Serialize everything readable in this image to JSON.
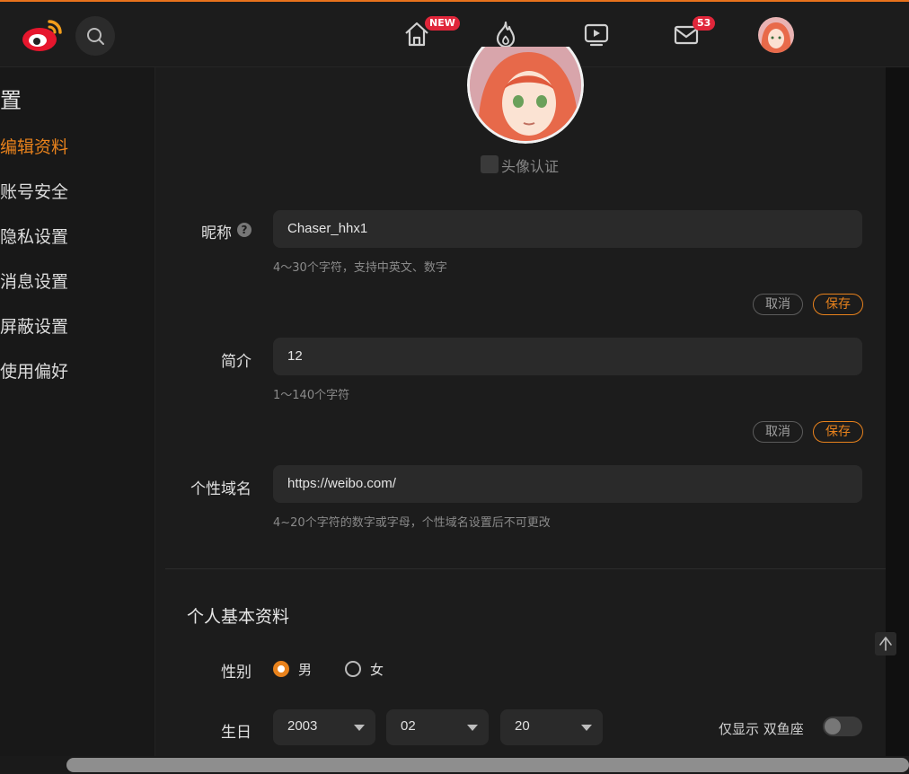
{
  "header": {
    "home_badge": "NEW",
    "messages_badge": "53"
  },
  "sidebar": {
    "title": "置",
    "items": [
      {
        "label": "编辑资料"
      },
      {
        "label": "账号安全"
      },
      {
        "label": "隐私设置"
      },
      {
        "label": "消息设置"
      },
      {
        "label": "屏蔽设置"
      },
      {
        "label": "使用偏好"
      }
    ]
  },
  "profile": {
    "verify_label": "头像认证",
    "nickname": {
      "label": "昵称",
      "help_icon": "?",
      "value": "Chaser_hhx1",
      "hint": "4～30个字符，支持中英文、数字",
      "cancel": "取消",
      "save": "保存"
    },
    "bio": {
      "label": "简介",
      "value": "12",
      "hint": "1～140个字符",
      "cancel": "取消",
      "save": "保存"
    },
    "domain": {
      "label": "个性域名",
      "prefix": "https://weibo.com/",
      "hint": "4~20个字符的数字或字母，个性域名设置后不可更改"
    }
  },
  "basic_info": {
    "title": "个人基本资料",
    "gender_label": "性别",
    "gender_options": [
      "男",
      "女"
    ],
    "gender_selected": "男",
    "birthday_label": "生日",
    "birthday": {
      "year": "2003",
      "month": "02",
      "day": "20"
    },
    "zodiac_toggle_label": "仅显示 双鱼座",
    "zodiac_toggle_on": false
  },
  "colors": {
    "accent": "#e8821c",
    "badge_red": "#e0263a"
  }
}
